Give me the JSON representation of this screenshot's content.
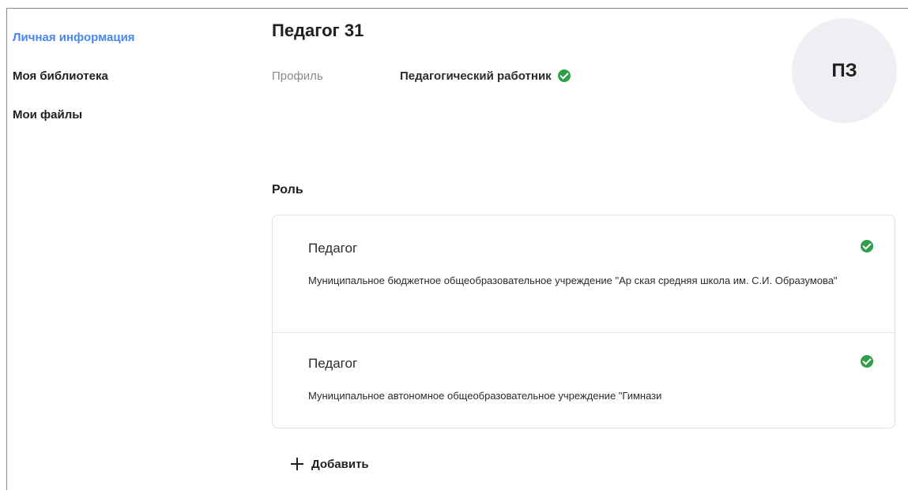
{
  "sidebar": {
    "items": [
      {
        "label": "Личная информация",
        "active": true
      },
      {
        "label": "Моя библиотека",
        "active": false
      },
      {
        "label": "Мои файлы",
        "active": false
      }
    ]
  },
  "header": {
    "title": "Педагог 31",
    "profile_label": "Профиль",
    "profile_value": "Педагогический работник",
    "avatar_initials": "ПЗ"
  },
  "roles": {
    "section_title": "Роль",
    "items": [
      {
        "title": "Педагог",
        "organization": "Муниципальное бюджетное общеобразовательное учреждение \"Ар          ская средняя школа         им. С.И. Образумова\"",
        "verified": true
      },
      {
        "title": "Педагог",
        "organization": "Муниципальное автономное общеобразовательное учреждение \"Гимнази",
        "verified": true
      }
    ],
    "add_label": "Добавить"
  },
  "colors": {
    "active_link": "#4a86f0",
    "check_green": "#2f9e4a",
    "avatar_bg": "#eeeff3",
    "muted_text": "#8a8a8a"
  }
}
